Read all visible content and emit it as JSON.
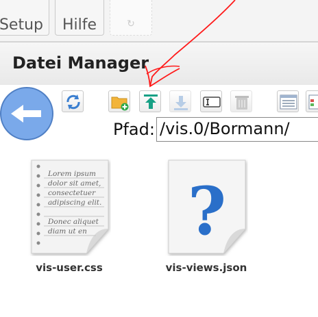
{
  "tabs": [
    {
      "label": "Setup"
    },
    {
      "label": "Hilfe"
    },
    {
      "label": "↻"
    }
  ],
  "dialog": {
    "title": "Datei Manager"
  },
  "toolbar": {
    "buttons": [
      {
        "name": "refresh-button",
        "icon": "refresh-icon"
      },
      {
        "name": "new-folder-button",
        "icon": "folder-add-icon"
      },
      {
        "name": "upload-button",
        "icon": "upload-icon"
      },
      {
        "name": "download-button",
        "icon": "download-icon"
      },
      {
        "name": "rename-button",
        "icon": "rename-icon"
      },
      {
        "name": "delete-button",
        "icon": "trash-icon"
      },
      {
        "name": "list-view-button",
        "icon": "list-view-icon"
      },
      {
        "name": "details-view-button",
        "icon": "details-view-icon"
      }
    ]
  },
  "path": {
    "label": "Pfad:",
    "value": "/vis.0/Bormann/"
  },
  "files": [
    {
      "name": "vis-user.css",
      "icon": "text-document-icon",
      "preview_lines": [
        "Lorem ipsum",
        "dolor sit amet,",
        "consectetuer",
        "adipiscing elit.",
        "Donec aliquet",
        "diam ut en"
      ]
    },
    {
      "name": "vis-views.json",
      "icon": "unknown-file-icon",
      "glyph": "?"
    }
  ],
  "annotation": {
    "color": "#ff1a1a"
  },
  "colors": {
    "back_button": "#7aa9ea",
    "upload_arrow": "#16a085",
    "question_mark": "#2a6fc9"
  }
}
